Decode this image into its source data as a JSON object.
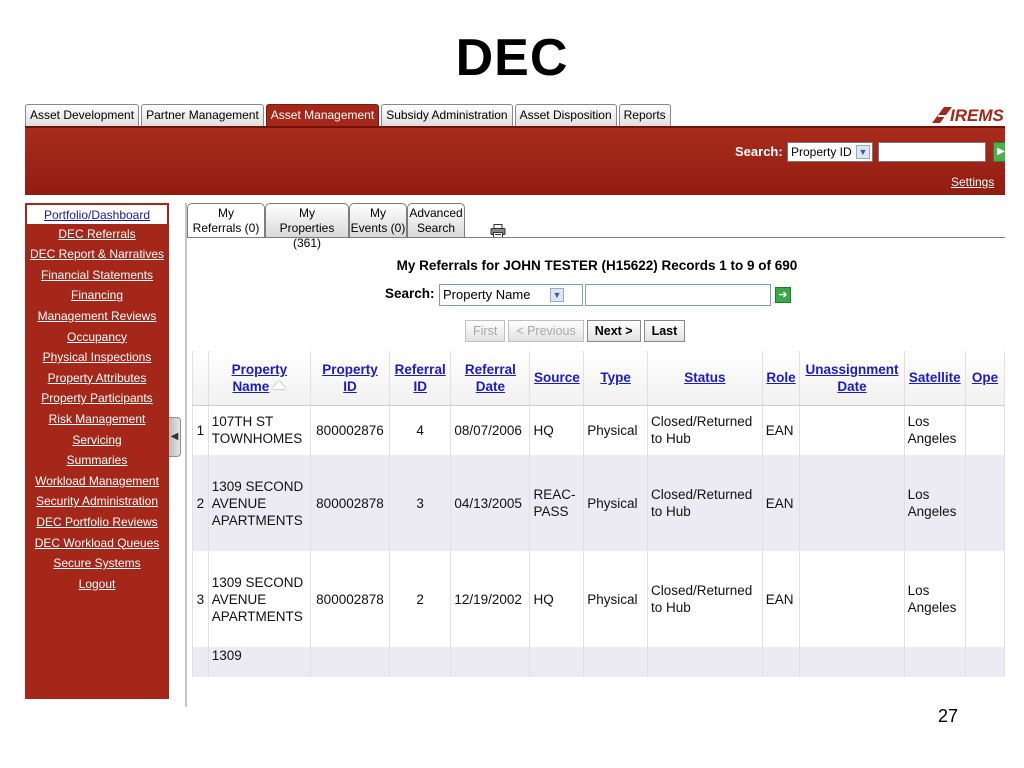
{
  "slide": {
    "title": "DEC",
    "page_number": "27"
  },
  "colors": {
    "brand_red": "#a4271a",
    "link_blue": "#1a1acc",
    "row_stripe": "#eceaf3"
  },
  "top_tabs": [
    {
      "label": "Asset Development",
      "active": false
    },
    {
      "label": "Partner Management",
      "active": false
    },
    {
      "label": "Asset Management",
      "active": true
    },
    {
      "label": "Subsidy Administration",
      "active": false
    },
    {
      "label": "Asset Disposition",
      "active": false
    },
    {
      "label": "Reports",
      "active": false
    }
  ],
  "logo": {
    "text": "IREMS",
    "icon": "irems-logo"
  },
  "header": {
    "search_label": "Search:",
    "search_select": "Property ID",
    "search_value": "",
    "settings_link": "Settings"
  },
  "sidebar": {
    "items": [
      "Portfolio/Dashboard",
      "DEC Referrals",
      "DEC Report & Narratives",
      "Financial Statements",
      "Financing",
      "Management Reviews",
      "Occupancy",
      "Physical Inspections",
      "Property Attributes",
      "Property Participants",
      "Risk Management",
      "Servicing",
      "Summaries",
      "Workload Management",
      "Security Administration",
      "DEC Portfolio Reviews",
      "DEC Workload Queues",
      "Secure Systems",
      "Logout"
    ]
  },
  "sub_tabs": [
    {
      "line1": "My",
      "line2": "Referrals (0)",
      "active": true
    },
    {
      "line1": "My",
      "line2": "Properties (361)",
      "active": false
    },
    {
      "line1": "My",
      "line2": "Events (0)",
      "active": false
    },
    {
      "line1": "Advanced",
      "line2": "Search",
      "active": false
    }
  ],
  "panel": {
    "title": "My Referrals for  JOHN TESTER  (H15622) Records 1 to 9 of 690",
    "search_label": "Search:",
    "search_select": "Property Name",
    "search_value": ""
  },
  "pager": {
    "first": "First",
    "previous": "< Previous",
    "next": "Next >",
    "last": "Last"
  },
  "table": {
    "columns": [
      "",
      "Property Name",
      "Property ID",
      "Referral ID",
      "Referral Date",
      "Source",
      "Type",
      "Status",
      "Role",
      "Unassignment Date",
      "Satellite",
      "Ope"
    ],
    "rows": [
      [
        "1",
        "107TH ST TOWNHOMES",
        "800002876",
        "4",
        "08/07/2006",
        "HQ",
        "Physical",
        "Closed/Returned to Hub",
        "EAN",
        "",
        "Los Angeles",
        ""
      ],
      [
        "2",
        "1309 SECOND AVENUE APARTMENTS",
        "800002878",
        "3",
        "04/13/2005",
        "REAC-PASS",
        "Physical",
        "Closed/Returned to Hub",
        "EAN",
        "",
        "Los Angeles",
        ""
      ],
      [
        "3",
        "1309 SECOND AVENUE APARTMENTS",
        "800002878",
        "2",
        "12/19/2002",
        "HQ",
        "Physical",
        "Closed/Returned to Hub",
        "EAN",
        "",
        "Los Angeles",
        ""
      ],
      [
        "",
        "1309",
        "",
        "",
        "",
        "",
        "",
        "",
        "",
        "",
        "",
        ""
      ]
    ]
  }
}
